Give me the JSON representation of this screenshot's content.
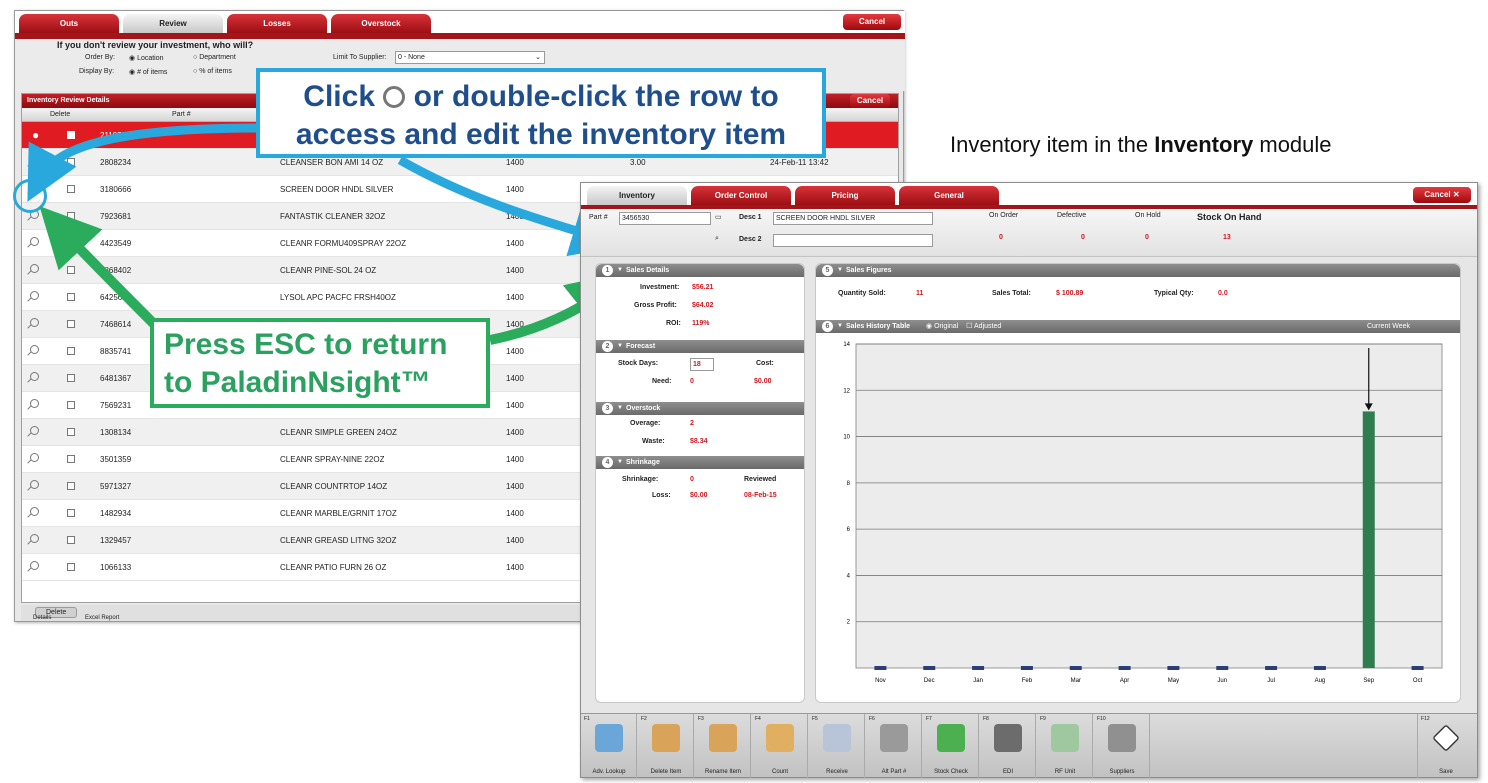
{
  "annotation": {
    "text_prefix": "Inventory item in the ",
    "text_bold": "Inventory",
    "text_suffix": " module"
  },
  "callout_blue": {
    "line1_a": "Click ",
    "line1_b": " or double-click the row to",
    "line2": "access and edit the inventory item"
  },
  "callout_green": {
    "line1": "Press ESC to return",
    "line2": "to PaladinNsight™"
  },
  "review_window": {
    "tabs": [
      {
        "label": "Outs"
      },
      {
        "label": "Review"
      },
      {
        "label": "Losses"
      },
      {
        "label": "Overstock"
      }
    ],
    "cancel_label": "Cancel",
    "heading": "If you don't review your investment, who will?",
    "order_by_label": "Order By:",
    "order_by_options": [
      "Location",
      "Department"
    ],
    "display_by_label": "Display By:",
    "display_by_options": [
      "# of items",
      "% of items"
    ],
    "limit_label": "Limit To Supplier:",
    "limit_value": "0 - None",
    "grid_title": "Inventory Review Details",
    "grid_cancel": "Cancel",
    "col_delete": "Delete",
    "col_part": "Part #",
    "rows": [
      {
        "part": "2119500",
        "desc": "",
        "qty": "",
        "val": "",
        "date": "23"
      },
      {
        "part": "2808234",
        "desc": "CLEANSER BON AMI 14 OZ",
        "qty": "1400",
        "val": "3.00",
        "date": "24-Feb-11 13:42"
      },
      {
        "part": "3180666",
        "desc": "SCREEN DOOR HNDL SILVER",
        "qty": "1400",
        "val": "",
        "date": ""
      },
      {
        "part": "7923681",
        "desc": "FANTASTIK CLEANER 32OZ",
        "qty": "1400",
        "val": "",
        "date": ""
      },
      {
        "part": "4423549",
        "desc": "CLEANR FORMU409SPRAY 22OZ",
        "qty": "1400",
        "val": "",
        "date": ""
      },
      {
        "part": "1868402",
        "desc": "CLEANR PINE-SOL 24 OZ",
        "qty": "1400",
        "val": "",
        "date": ""
      },
      {
        "part": "6425613",
        "desc": "LYSOL APC PACFC FRSH40OZ",
        "qty": "1400",
        "val": "",
        "date": ""
      },
      {
        "part": "7468614",
        "desc": "",
        "qty": "1400",
        "val": "",
        "date": ""
      },
      {
        "part": "8835741",
        "desc": "",
        "qty": "1400",
        "val": "",
        "date": ""
      },
      {
        "part": "6481367",
        "desc": "",
        "qty": "1400",
        "val": "",
        "date": ""
      },
      {
        "part": "7569231",
        "desc": "",
        "qty": "1400",
        "val": "",
        "date": ""
      },
      {
        "part": "1308134",
        "desc": "CLEANR SIMPLE GREEN 24OZ",
        "qty": "1400",
        "val": "",
        "date": ""
      },
      {
        "part": "3501359",
        "desc": "CLEANR SPRAY-NINE 22OZ",
        "qty": "1400",
        "val": "",
        "date": ""
      },
      {
        "part": "5971327",
        "desc": "CLEANR COUNTRTOP 14OZ",
        "qty": "1400",
        "val": "",
        "date": ""
      },
      {
        "part": "1482934",
        "desc": "CLEANR MARBLE/GRNIT 17OZ",
        "qty": "1400",
        "val": "",
        "date": ""
      },
      {
        "part": "1329457",
        "desc": "CLEANR GREASD LITNG 32OZ",
        "qty": "1400",
        "val": "",
        "date": ""
      },
      {
        "part": "1066133",
        "desc": "CLEANR PATIO FURN 26 OZ",
        "qty": "1400",
        "val": "",
        "date": ""
      }
    ],
    "footer_button": "Delete",
    "footer_tabs": [
      "Details",
      "Excel Report"
    ]
  },
  "inventory_window": {
    "tabs": [
      {
        "label": "Inventory"
      },
      {
        "label": "Order Control"
      },
      {
        "label": "Pricing"
      },
      {
        "label": "General"
      }
    ],
    "cancel_label": "Cancel",
    "part_label": "Part #",
    "part_value": "3456530",
    "desc1_label": "Desc 1",
    "desc1_value": "SCREEN DOOR HNDL SILVER",
    "desc2_label": "Desc 2",
    "desc2_value": "",
    "on_order_label": "On Order",
    "on_order_value": "0",
    "defective_label": "Defective",
    "defective_value": "0",
    "on_hold_label": "On Hold",
    "on_hold_value": "0",
    "stock_label": "Stock On Hand",
    "stock_value": "13",
    "sales_details": {
      "title": "Sales Details",
      "investment_label": "Investment:",
      "investment_value": "$56.21",
      "gross_label": "Gross Profit:",
      "gross_value": "$64.02",
      "roi_label": "ROI:",
      "roi_value": "119%"
    },
    "forecast": {
      "title": "Forecast",
      "stock_days_label": "Stock Days:",
      "stock_days_value": "18",
      "cost_label": "Cost:",
      "cost_value": "$0.00",
      "need_label": "Need:",
      "need_value": "0"
    },
    "overstock": {
      "title": "Overstock",
      "overage_label": "Overage:",
      "overage_value": "2",
      "waste_label": "Waste:",
      "waste_value": "$8.34"
    },
    "shrinkage": {
      "title": "Shrinkage",
      "shrinkage_label": "Shrinkage:",
      "shrinkage_value": "0",
      "reviewed_label": "Reviewed",
      "loss_label": "Loss:",
      "loss_value": "$0.00",
      "reviewed_value": "08-Feb-15"
    },
    "sales_figures": {
      "title": "Sales Figures",
      "qty_sold_label": "Quantity Sold:",
      "qty_sold_value": "11",
      "sales_total_label": "Sales Total:",
      "sales_total_value": "$ 100.89",
      "typical_label": "Typical Qty:",
      "typical_value": "0.0"
    },
    "history": {
      "title": "Sales History Table",
      "opt_original": "Original",
      "opt_adjusted": "Adjusted",
      "current_week": "Current Week"
    },
    "toolbar": [
      {
        "key": "F1",
        "label": "Adv. Lookup",
        "color": "#6aa6d8"
      },
      {
        "key": "F2",
        "label": "Delete Item",
        "color": "#d9a35a"
      },
      {
        "key": "F3",
        "label": "Rename Item",
        "color": "#d9a35a"
      },
      {
        "key": "F4",
        "label": "Count",
        "color": "#e0b060"
      },
      {
        "key": "F5",
        "label": "Receive",
        "color": "#b8c4d8"
      },
      {
        "key": "F6",
        "label": "Alt Part #",
        "color": "#9a9a9a"
      },
      {
        "key": "F7",
        "label": "Stock Check",
        "color": "#4caf50"
      },
      {
        "key": "F8",
        "label": "EDI",
        "color": "#6c6c6c"
      },
      {
        "key": "F9",
        "label": "RF Unit",
        "color": "#a0c8a0"
      },
      {
        "key": "F10",
        "label": "Suppliers",
        "color": "#909090"
      }
    ],
    "save_key": "F12",
    "save_label": "Save"
  },
  "chart_data": {
    "type": "bar",
    "categories": [
      "Nov",
      "Dec",
      "Jan",
      "Feb",
      "Mar",
      "Apr",
      "May",
      "Jun",
      "Jul",
      "Aug",
      "Sep",
      "Oct"
    ],
    "values": [
      0,
      0,
      0,
      0,
      0,
      0,
      0,
      0,
      0,
      0,
      11,
      0
    ],
    "title": "",
    "xlabel": "",
    "ylabel": "",
    "ylim": [
      0,
      14
    ],
    "yticks": [
      2,
      4,
      6,
      8,
      10,
      12,
      14
    ],
    "colors": {
      "bar": "#2e7d4f"
    },
    "grid": true
  }
}
